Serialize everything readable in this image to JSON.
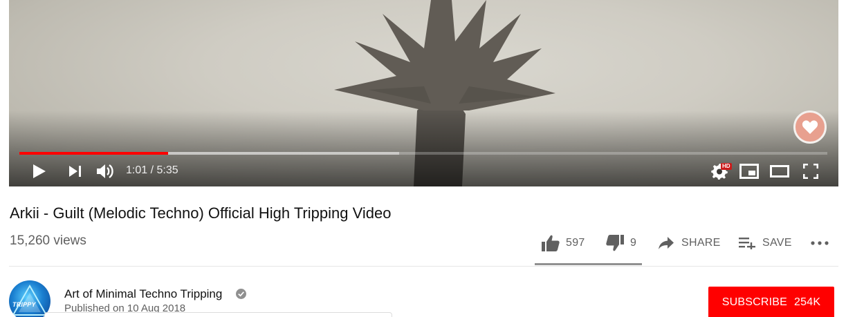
{
  "player": {
    "current_time": "1:01",
    "duration": "5:35",
    "played_fraction": 0.184,
    "buffered_fraction": 0.47,
    "hd_badge": "HD",
    "icons": [
      "play-icon",
      "next-icon",
      "volume-icon",
      "settings-icon",
      "miniplayer-icon",
      "theater-mode-icon",
      "fullscreen-icon",
      "heart-icon"
    ],
    "colors": {
      "progress_played": "#ff0000",
      "heart": "#e8a08f"
    }
  },
  "video": {
    "title": "Arkii - Guilt (Melodic Techno) Official High Tripping Video",
    "views": "15,260 views"
  },
  "actions": {
    "likes": "597",
    "dislikes": "9",
    "share_label": "SHARE",
    "save_label": "SAVE",
    "like_fraction": 0.985
  },
  "channel": {
    "name": "Art of Minimal Techno Tripping",
    "published": "Published on 10 Aug 2018",
    "avatar_text": "TRIPPY",
    "subscribe_label": "SUBSCRIBE",
    "subscriber_count": "254K",
    "colors": {
      "subscribe": "#ff0000"
    }
  }
}
